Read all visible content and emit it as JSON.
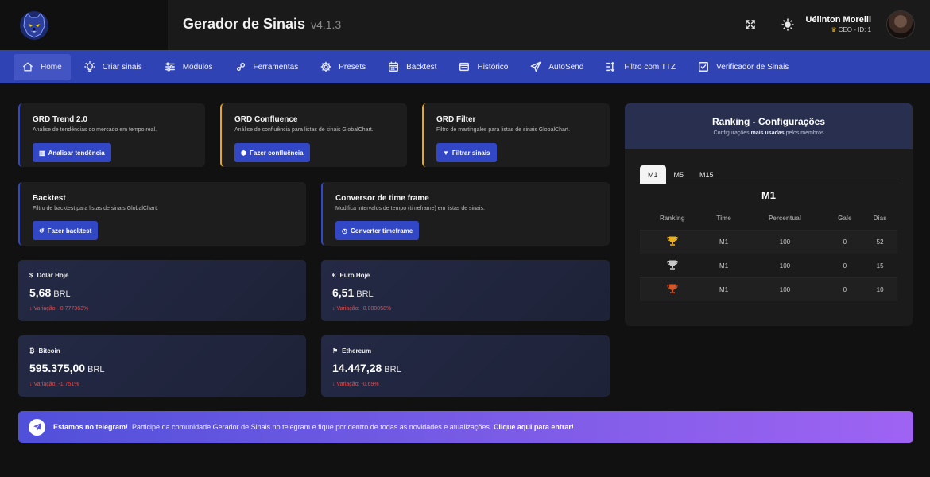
{
  "header": {
    "title": "Gerador de Sinais",
    "version": "v4.1.3",
    "user_name": "Uélinton Morelli",
    "user_role": "CEO - ID: 1"
  },
  "nav": {
    "items": [
      {
        "label": "Home",
        "icon": "home-icon"
      },
      {
        "label": "Criar sinais",
        "icon": "lightbulb-icon"
      },
      {
        "label": "Módulos",
        "icon": "sliders-icon"
      },
      {
        "label": "Ferramentas",
        "icon": "wrench-icon"
      },
      {
        "label": "Presets",
        "icon": "gear-icon"
      },
      {
        "label": "Backtest",
        "icon": "calendar-icon"
      },
      {
        "label": "Histórico",
        "icon": "history-icon"
      },
      {
        "label": "AutoSend",
        "icon": "send-icon"
      },
      {
        "label": "Filtro com TTZ",
        "icon": "filter-list-icon"
      },
      {
        "label": "Verificador de Sinais",
        "icon": "check-square-icon"
      }
    ]
  },
  "cards": {
    "trend": {
      "title": "GRD Trend 2.0",
      "desc": "Análise de tendências do mercado em tempo real.",
      "button": "Analisar tendência"
    },
    "confluence": {
      "title": "GRD Confluence",
      "desc": "Análise de confluência para listas de sinais GlobalChart.",
      "button": "Fazer confluência"
    },
    "filter": {
      "title": "GRD Filter",
      "desc": "Filtro de martingales para listas de sinais GlobalChart.",
      "button": "Filtrar sinais"
    },
    "backtest": {
      "title": "Backtest",
      "desc": "Filtro de backtest para listas de sinais GlobalChart.",
      "button": "Fazer backtest"
    },
    "converter": {
      "title": "Conversor de time frame",
      "desc": "Modifica intervalos de tempo (timeframe) em listas de sinais.",
      "button": "Converter timeframe"
    }
  },
  "stats": {
    "dolar": {
      "label": "Dólar Hoje",
      "value": "5,68",
      "unit": "BRL",
      "variation": "Variação: -0.777363%"
    },
    "euro": {
      "label": "Euro Hoje",
      "value": "6,51",
      "unit": "BRL",
      "variation": "Variação: -0.000058%"
    },
    "bitcoin": {
      "label": "Bitcoin",
      "value": "595.375,00",
      "unit": "BRL",
      "variation": "Variação: -1.751%"
    },
    "ethereum": {
      "label": "Ethereum",
      "value": "14.447,28",
      "unit": "BRL",
      "variation": "Variação: -0.69%"
    }
  },
  "ranking": {
    "title": "Ranking - Configurações",
    "subtitle_pre": "Configurações",
    "subtitle_bold": "mais usadas",
    "subtitle_post": "pelos membros",
    "tabs": [
      "M1",
      "M5",
      "M15"
    ],
    "selected": "M1",
    "columns": [
      "Ranking",
      "Time",
      "Percentual",
      "Gale",
      "Dias"
    ],
    "rows": [
      {
        "trophy": "gold-trophy-icon",
        "time": "M1",
        "percentual": "100",
        "gale": "0",
        "dias": "52"
      },
      {
        "trophy": "silver-trophy-icon",
        "time": "M1",
        "percentual": "100",
        "gale": "0",
        "dias": "15"
      },
      {
        "trophy": "bronze-trophy-icon",
        "time": "M1",
        "percentual": "100",
        "gale": "0",
        "dias": "10"
      }
    ]
  },
  "banner": {
    "bold": "Estamos no telegram!",
    "text": "Participe da comunidade Gerador de Sinais no telegram e fique por dentro de todas as novidades e atualizações.",
    "cta": "Clique aqui para entrar!"
  },
  "colors": {
    "accent": "#2f43b5",
    "yellow_border": "#e8a915",
    "negative": "#e84a4a"
  }
}
